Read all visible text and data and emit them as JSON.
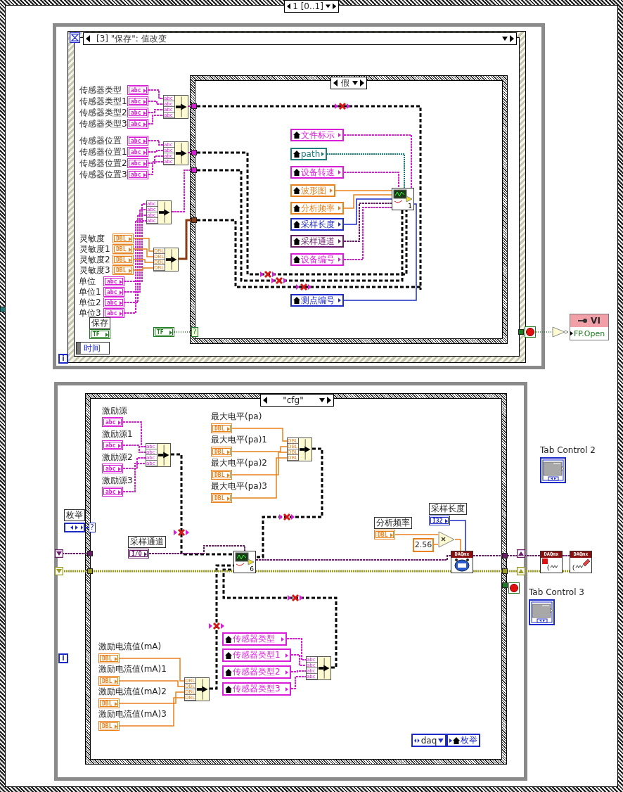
{
  "sequence": {
    "selector": "1 [0..1]"
  },
  "event_structure": {
    "case": "[3] \"保存\": 值改变",
    "event_data": "时间",
    "iteration": "i",
    "controls": [
      {
        "label": "传感器类型",
        "kind": "string",
        "type_text": "abc"
      },
      {
        "label": "传感器类型1",
        "kind": "string",
        "type_text": "abc"
      },
      {
        "label": "传感器类型2",
        "kind": "string",
        "type_text": "abc"
      },
      {
        "label": "传感器类型3",
        "kind": "string",
        "type_text": "abc"
      },
      {
        "label": "传感器位置",
        "kind": "string",
        "type_text": "abc"
      },
      {
        "label": "传感器位置1",
        "kind": "string",
        "type_text": "abc"
      },
      {
        "label": "传感器位置2",
        "kind": "string",
        "type_text": "abc"
      },
      {
        "label": "传感器位置3",
        "kind": "string",
        "type_text": "abc"
      },
      {
        "label": "灵敏度",
        "kind": "numeric",
        "type_text": "DBL"
      },
      {
        "label": "灵敏度1",
        "kind": "numeric",
        "type_text": "DBL"
      },
      {
        "label": "灵敏度2",
        "kind": "numeric",
        "type_text": "DBL"
      },
      {
        "label": "灵敏度3",
        "kind": "numeric",
        "type_text": "DBL"
      },
      {
        "label": "单位",
        "kind": "string",
        "type_text": "abc"
      },
      {
        "label": "单位1",
        "kind": "string",
        "type_text": "abc"
      },
      {
        "label": "单位2",
        "kind": "string",
        "type_text": "abc"
      },
      {
        "label": "单位3",
        "kind": "string",
        "type_text": "abc"
      },
      {
        "label": "保存",
        "kind": "boolean",
        "type_text": "TF"
      }
    ],
    "build_arrays": [
      {
        "kind": "string",
        "inputs": [
          "abc",
          "abc",
          "abc",
          "abc"
        ]
      },
      {
        "kind": "string",
        "inputs": [
          "abc",
          "abc",
          "abc",
          "abc"
        ]
      },
      {
        "kind": "string",
        "inputs": [
          "abc",
          "abc",
          "abc",
          "abc"
        ]
      },
      {
        "kind": "numeric",
        "inputs": [
          "DBL",
          "DBL",
          "DBL",
          "DBL"
        ]
      }
    ],
    "constant": {
      "kind": "boolean",
      "type_text": "TF"
    },
    "case_structure": {
      "selector": "假",
      "selector_tunnel": "?",
      "locals": [
        {
          "label": "文件标示",
          "kind": "string"
        },
        {
          "label": "path",
          "kind": "path"
        },
        {
          "label": "设备转速",
          "kind": "string"
        },
        {
          "label": "波形图",
          "kind": "numeric"
        },
        {
          "label": "分析频率",
          "kind": "numeric"
        },
        {
          "label": "采样长度",
          "kind": "integer"
        },
        {
          "label": "采样通道",
          "kind": "io"
        },
        {
          "label": "设备编号",
          "kind": "string"
        },
        {
          "label": "测点编号",
          "kind": "integer"
        }
      ],
      "subvi": {
        "number": "1"
      }
    }
  },
  "after_event": {
    "invoke_class": "VI",
    "invoke_property": "FP.Open"
  },
  "while_loop": {
    "iteration": "i",
    "enum_control": {
      "label": "枚举"
    },
    "case_structure": {
      "selector": "\"cfg\"",
      "selector_tunnel": "?",
      "controls": [
        {
          "label": "激励源",
          "kind": "string",
          "type_text": "abc"
        },
        {
          "label": "激励源1",
          "kind": "string",
          "type_text": "abc"
        },
        {
          "label": "激励源2",
          "kind": "string",
          "type_text": "abc"
        },
        {
          "label": "激励源3",
          "kind": "string",
          "type_text": "abc"
        },
        {
          "label": "最大电平(pa)",
          "kind": "numeric",
          "type_text": "DBL"
        },
        {
          "label": "最大电平(pa)1",
          "kind": "numeric",
          "type_text": "DBL"
        },
        {
          "label": "最大电平(pa)2",
          "kind": "numeric",
          "type_text": "DBL"
        },
        {
          "label": "最大电平(pa)3",
          "kind": "numeric",
          "type_text": "DBL"
        },
        {
          "label": "采样通道",
          "kind": "io",
          "type_text": "I/O"
        },
        {
          "label": "分析频率",
          "kind": "numeric",
          "type_text": "DBL"
        },
        {
          "label": "采样长度",
          "kind": "integer",
          "type_text": "I32"
        },
        {
          "label": "激励电流值(mA)",
          "kind": "numeric",
          "type_text": "DBL"
        },
        {
          "label": "激励电流值(mA)1",
          "kind": "numeric",
          "type_text": "DBL"
        },
        {
          "label": "激励电流值(mA)2",
          "kind": "numeric",
          "type_text": "DBL"
        },
        {
          "label": "激励电流值(mA)3",
          "kind": "numeric",
          "type_text": "DBL"
        }
      ],
      "build_arrays": [
        {
          "kind": "string",
          "inputs": [
            "abc",
            "abc",
            "abc",
            "abc"
          ]
        },
        {
          "kind": "numeric",
          "inputs": [
            "DBL",
            "DBL",
            "DBL",
            "DBL"
          ]
        },
        {
          "kind": "numeric",
          "inputs": [
            "DBL",
            "DBL",
            "DBL",
            "DBL"
          ]
        },
        {
          "kind": "string",
          "inputs": [
            "abc",
            "abc",
            "abc",
            "abc"
          ]
        }
      ],
      "locals": [
        {
          "label": "传感器类型",
          "kind": "string"
        },
        {
          "label": "传感器类型1",
          "kind": "string"
        },
        {
          "label": "传感器类型2",
          "kind": "string"
        },
        {
          "label": "传感器类型3",
          "kind": "string"
        }
      ],
      "constant": "2.56",
      "subvi": {
        "number": "6"
      },
      "daqmx": [
        {
          "banner": "DAQmx",
          "kind": "timing"
        }
      ],
      "enum_constant": "daq",
      "enum_local": "枚举"
    },
    "daqmx_after": [
      {
        "banner": "DAQmx",
        "kind": "stop"
      },
      {
        "banner": "DAQmx",
        "kind": "clear"
      }
    ],
    "tab_controls": [
      {
        "label": "Tab Control 2"
      },
      {
        "label": "Tab Control 3"
      }
    ]
  }
}
